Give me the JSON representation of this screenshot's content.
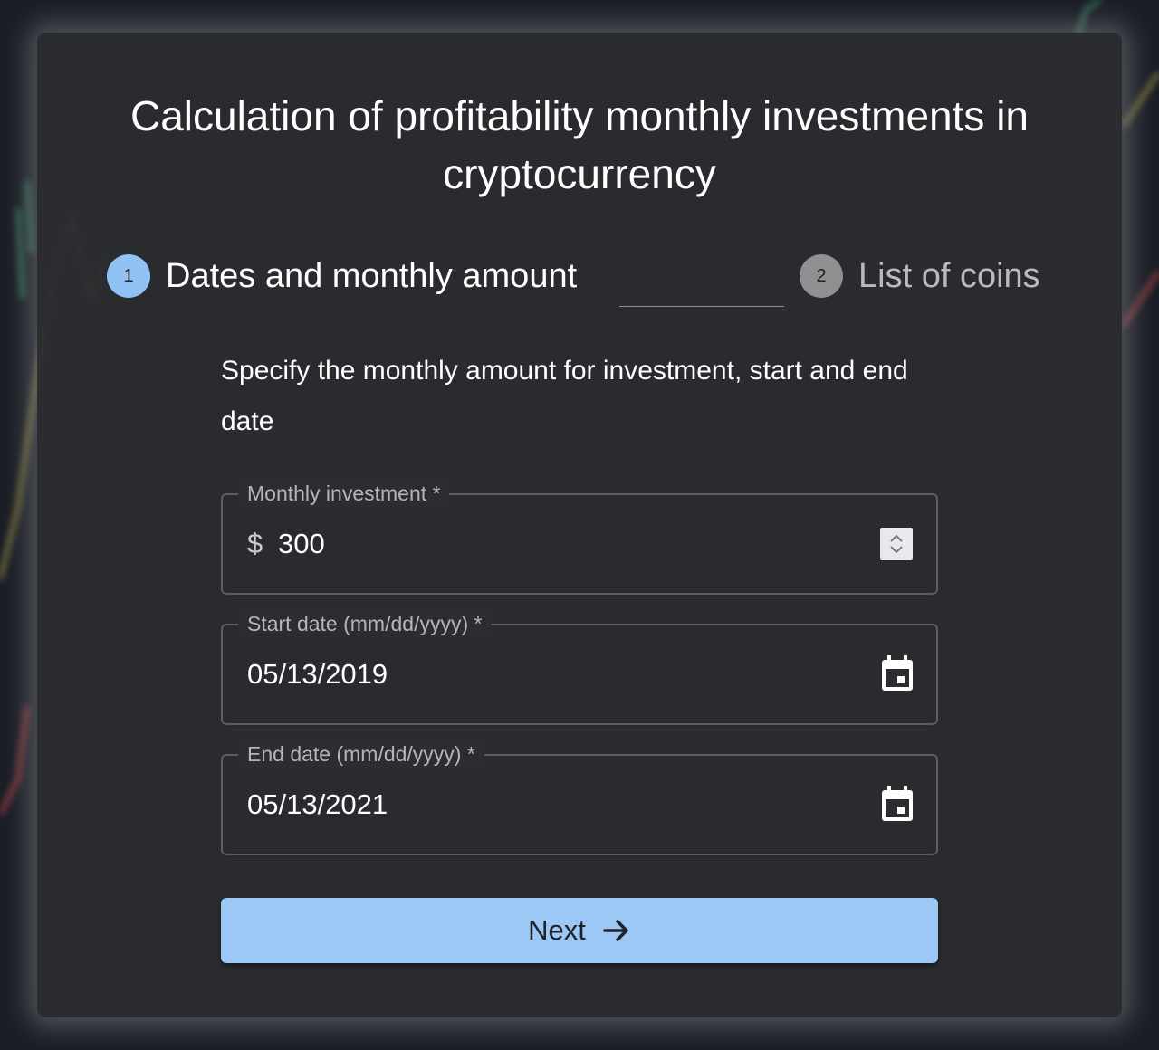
{
  "page": {
    "title": "Calculation of profitability monthly investments in cryptocurrency"
  },
  "stepper": {
    "steps": [
      {
        "number": "1",
        "label": "Dates and monthly amount",
        "active": true
      },
      {
        "number": "2",
        "label": "List of coins",
        "active": false
      }
    ]
  },
  "form": {
    "instructions": "Specify the monthly amount for investment, start and end date",
    "monthly_investment": {
      "label": "Monthly investment *",
      "prefix": "$",
      "value": "300"
    },
    "start_date": {
      "label": "Start date (mm/dd/yyyy) *",
      "value": "05/13/2019"
    },
    "end_date": {
      "label": "End date (mm/dd/yyyy) *",
      "value": "05/13/2021"
    },
    "next_button": {
      "label": "Next"
    }
  },
  "icons": {
    "spinner": "spin-up-down-icon",
    "calendar": "calendar-icon",
    "next": "arrow-right-icon"
  },
  "colors": {
    "accent": "#9bc8f4",
    "card": "#2c2d30",
    "inactive_step": "#8f9092"
  }
}
